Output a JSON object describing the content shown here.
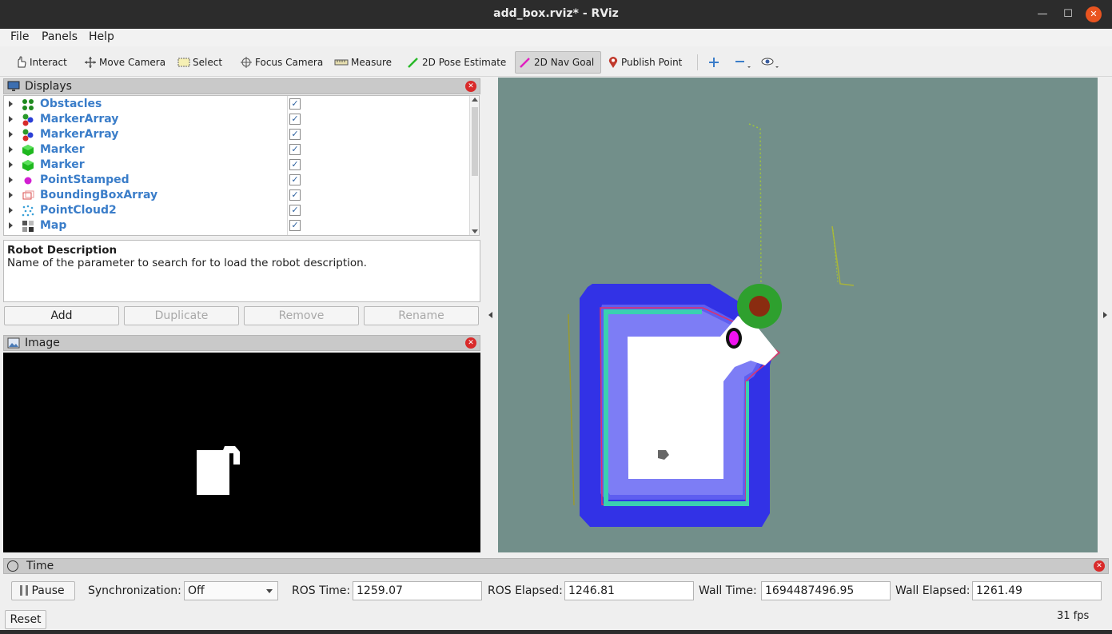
{
  "window": {
    "title": "add_box.rviz* - RViz"
  },
  "menu": [
    "File",
    "Panels",
    "Help"
  ],
  "toolbar": {
    "tools": [
      {
        "label": "Interact",
        "icon": "hand-pointer-icon"
      },
      {
        "label": "Move Camera",
        "icon": "move-camera-icon"
      },
      {
        "label": "Select",
        "icon": "select-rect-icon"
      },
      {
        "label": "Focus Camera",
        "icon": "focus-camera-icon"
      },
      {
        "label": "Measure",
        "icon": "ruler-icon"
      },
      {
        "label": "2D Pose Estimate",
        "icon": "green-arrow-icon"
      },
      {
        "label": "2D Nav Goal",
        "icon": "magenta-arrow-icon",
        "active": true
      },
      {
        "label": "Publish Point",
        "icon": "map-pin-icon"
      }
    ]
  },
  "displays": {
    "title": "Displays",
    "items": [
      {
        "label": "Obstacles",
        "checked": true,
        "icon": "green-dots-icon"
      },
      {
        "label": "MarkerArray",
        "checked": true,
        "icon": "marker-array-icon"
      },
      {
        "label": "MarkerArray",
        "checked": true,
        "icon": "marker-array-icon"
      },
      {
        "label": "Marker",
        "checked": true,
        "icon": "green-cube-icon"
      },
      {
        "label": "Marker",
        "checked": true,
        "icon": "green-cube-icon"
      },
      {
        "label": "PointStamped",
        "checked": true,
        "icon": "magenta-point-icon"
      },
      {
        "label": "BoundingBoxArray",
        "checked": true,
        "icon": "bounding-box-icon"
      },
      {
        "label": "PointCloud2",
        "checked": true,
        "icon": "point-cloud-icon"
      },
      {
        "label": "Map",
        "checked": true,
        "icon": "map-grid-icon"
      }
    ],
    "description": {
      "title": "Robot Description",
      "text": "Name of the parameter to search for to load the robot description."
    },
    "buttons": {
      "add": "Add",
      "duplicate": "Duplicate",
      "remove": "Remove",
      "rename": "Rename"
    }
  },
  "image_panel": {
    "title": "Image"
  },
  "time_panel": {
    "title": "Time",
    "pause_label": "Pause",
    "sync_label": "Synchronization:",
    "sync_value": "Off",
    "ros_time_label": "ROS Time:",
    "ros_time": "1259.07",
    "ros_elapsed_label": "ROS Elapsed:",
    "ros_elapsed": "1246.81",
    "wall_time_label": "Wall Time:",
    "wall_time": "1694487496.95",
    "wall_elapsed_label": "Wall Elapsed:",
    "wall_elapsed": "1261.49",
    "reset_label": "Reset",
    "fps": "31 fps"
  },
  "colors": {
    "viewport_bg": "#728f8a",
    "costmap_blue": "#3232e6",
    "link_blue": "#3a7dc9",
    "active_tool_bg": "#d7d7d7",
    "close_red": "#d92a2a"
  }
}
